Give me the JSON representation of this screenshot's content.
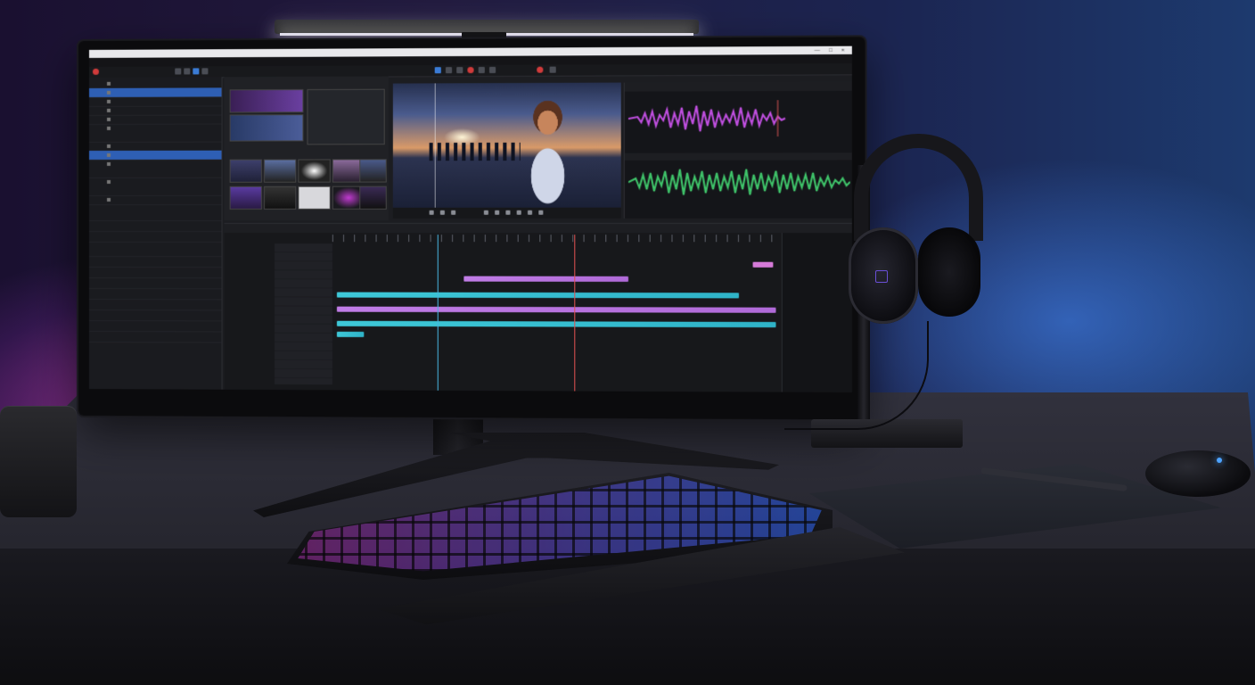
{
  "scene": {
    "description_colors": {
      "accent_purple": "#c07ce6",
      "accent_cyan": "#3ec8d8",
      "accent_green": "#3fc46a",
      "selection_blue": "#2e5fb4"
    }
  },
  "screen_ui": {
    "window_controls": "— □ ×",
    "sidebar_items": [
      {
        "icon": "folder-icon",
        "selected": false
      },
      {
        "icon": "sequence-icon",
        "selected": true
      },
      {
        "icon": "clip-icon",
        "selected": false
      },
      {
        "icon": "clip-icon",
        "selected": false
      },
      {
        "icon": "clip-icon",
        "selected": false
      },
      {
        "icon": "clip-icon",
        "selected": false
      },
      {
        "icon": "clip-icon",
        "selected": false
      },
      {
        "icon": "clip-icon",
        "selected": false
      },
      {
        "icon": "sequence-icon",
        "selected": true
      },
      {
        "icon": "clip-icon",
        "selected": false
      },
      {
        "icon": "clip-icon",
        "selected": false
      },
      {
        "icon": "clip-icon",
        "selected": false
      },
      {
        "icon": "clip-icon",
        "selected": false
      }
    ]
  }
}
